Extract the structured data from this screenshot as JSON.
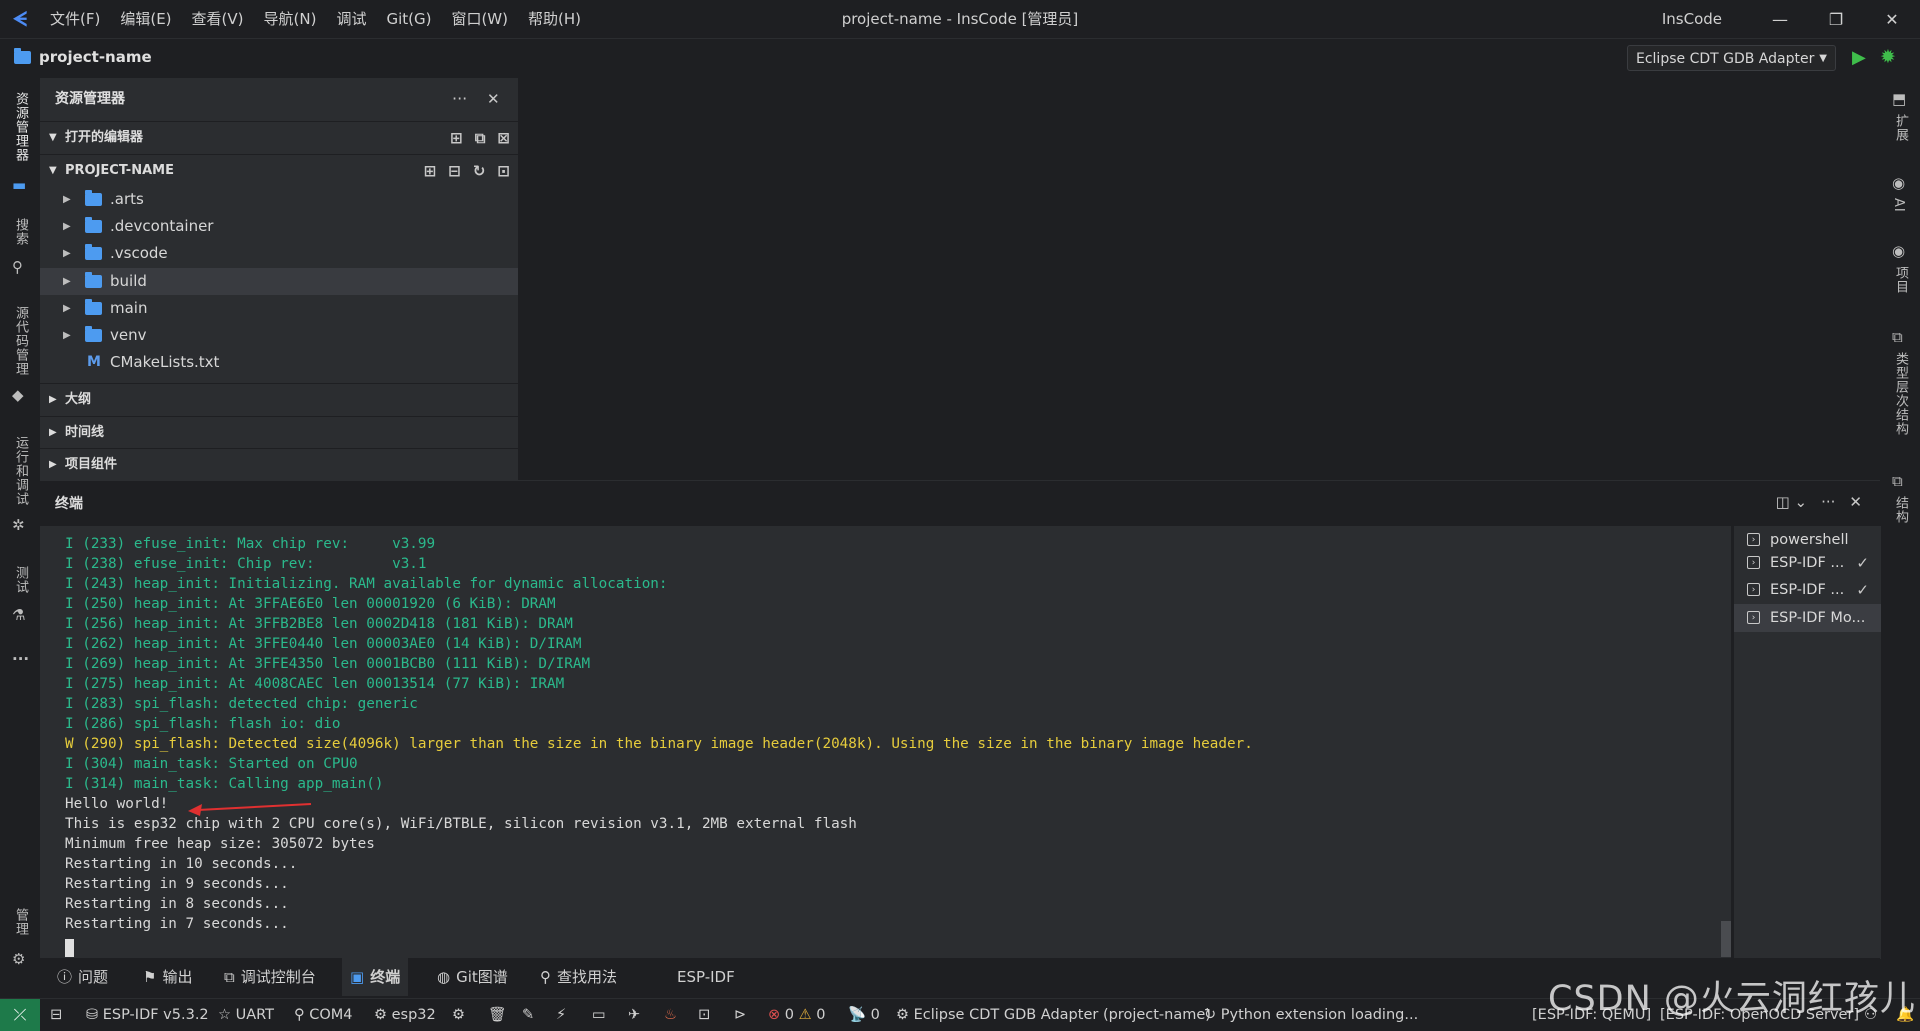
{
  "titlebar": {
    "menu": [
      "文件(F)",
      "编辑(E)",
      "查看(V)",
      "导航(N)",
      "调试",
      "Git(G)",
      "窗口(W)",
      "帮助(H)"
    ],
    "window_title": "project-name - InsCode [管理员]",
    "brand": "InsCode",
    "controls": [
      "—",
      "❐",
      "✕"
    ]
  },
  "projectbar": {
    "project_name": "project-name",
    "debug_config": "Eclipse CDT GDB Adapter"
  },
  "activity_left": {
    "items": [
      "资源管理器",
      "搜索",
      "源代码管理",
      "运行和调试",
      "测试"
    ],
    "more": "···",
    "manage": "管理"
  },
  "activity_right": {
    "items": [
      "扩展",
      "AI",
      "项目",
      "类型层次结构",
      "结构"
    ]
  },
  "explorer": {
    "title": "资源管理器",
    "sections": {
      "open_editors": "打开的编辑器",
      "project": "PROJECT-NAME",
      "outline": "大纲",
      "timeline": "时间线",
      "components": "项目组件"
    },
    "tree": [
      {
        "name": ".arts",
        "type": "folder-special"
      },
      {
        "name": ".devcontainer",
        "type": "folder"
      },
      {
        "name": ".vscode",
        "type": "folder"
      },
      {
        "name": "build",
        "type": "folder-special",
        "selected": true
      },
      {
        "name": "main",
        "type": "folder"
      },
      {
        "name": "venv",
        "type": "folder"
      },
      {
        "name": "CMakeLists.txt",
        "type": "file"
      }
    ]
  },
  "terminal": {
    "title": "终端",
    "lines": [
      {
        "kind": "info",
        "text": "I (233) efuse_init: Max chip rev:     v3.99"
      },
      {
        "kind": "info",
        "text": "I (238) efuse_init: Chip rev:         v3.1"
      },
      {
        "kind": "info",
        "text": "I (243) heap_init: Initializing. RAM available for dynamic allocation:"
      },
      {
        "kind": "info",
        "text": "I (250) heap_init: At 3FFAE6E0 len 00001920 (6 KiB): DRAM"
      },
      {
        "kind": "info",
        "text": "I (256) heap_init: At 3FFB2BE8 len 0002D418 (181 KiB): DRAM"
      },
      {
        "kind": "info",
        "text": "I (262) heap_init: At 3FFE0440 len 00003AE0 (14 KiB): D/IRAM"
      },
      {
        "kind": "info",
        "text": "I (269) heap_init: At 3FFE4350 len 0001BCB0 (111 KiB): D/IRAM"
      },
      {
        "kind": "info",
        "text": "I (275) heap_init: At 4008CAEC len 00013514 (77 KiB): IRAM"
      },
      {
        "kind": "info",
        "text": "I (283) spi_flash: detected chip: generic"
      },
      {
        "kind": "info",
        "text": "I (286) spi_flash: flash io: dio"
      },
      {
        "kind": "warn",
        "text": "W (290) spi_flash: Detected size(4096k) larger than the size in the binary image header(2048k). Using the size in the binary image header."
      },
      {
        "kind": "info",
        "text": "I (304) main_task: Started on CPU0"
      },
      {
        "kind": "info",
        "text": "I (314) main_task: Calling app_main()"
      },
      {
        "kind": "plain",
        "text": "Hello world!"
      },
      {
        "kind": "plain",
        "text": "This is esp32 chip with 2 CPU core(s), WiFi/BTBLE, silicon revision v3.1, 2MB external flash"
      },
      {
        "kind": "plain",
        "text": "Minimum free heap size: 305072 bytes"
      },
      {
        "kind": "plain",
        "text": "Restarting in 10 seconds..."
      },
      {
        "kind": "plain",
        "text": "Restarting in 9 seconds..."
      },
      {
        "kind": "plain",
        "text": "Restarting in 8 seconds..."
      },
      {
        "kind": "plain",
        "text": "Restarting in 7 seconds..."
      }
    ],
    "sessions": [
      {
        "name": "powershell",
        "checked": false,
        "active": false
      },
      {
        "name": "ESP-IDF ...",
        "checked": true,
        "active": false
      },
      {
        "name": "ESP-IDF ...",
        "checked": true,
        "active": false
      },
      {
        "name": "ESP-IDF Mo...",
        "checked": false,
        "active": true
      }
    ]
  },
  "bottom_tabs": [
    "问题",
    "输出",
    "调试控制台",
    "终端",
    "Git图谱",
    "查找用法",
    "ESP-IDF"
  ],
  "statusbar": {
    "esp_idf_version": "ESP-IDF v5.3.2",
    "uart": "UART",
    "port": "COM4",
    "target": "esp32",
    "errors": "0",
    "warnings": "0",
    "ports": "0",
    "debug_adapter": "Eclipse CDT GDB Adapter (project-name)",
    "python": "Python extension loading...",
    "qemu": "[ESP-IDF: QEMU]",
    "openocd": "[ESP-IDF: OpenOCD Server]"
  },
  "watermark": "CSDN @火云洞红孩儿",
  "colors": {
    "accent": "#4d9bf0",
    "run_green": "#3fbd4b",
    "info_green": "#2bb98c",
    "warn_yellow": "#e6cc3c",
    "remote_green": "#1e7a4a"
  }
}
